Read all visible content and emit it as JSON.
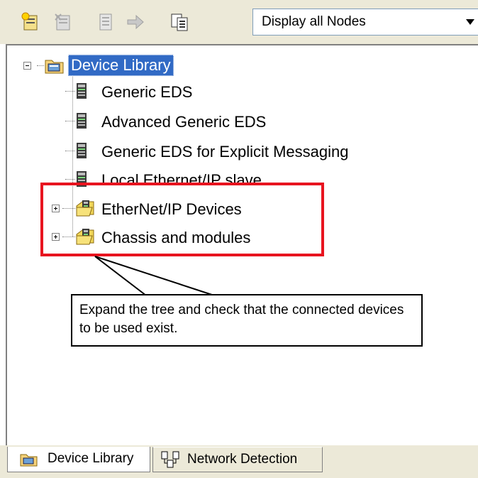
{
  "toolbar": {
    "buttons": [
      {
        "icon": "add-device-icon"
      },
      {
        "icon": "remove-device-icon"
      },
      {
        "icon": "properties-icon"
      },
      {
        "icon": "arrow-right-icon"
      },
      {
        "icon": "copy-icon"
      }
    ],
    "filter_value": "Display all Nodes"
  },
  "tree": {
    "root": {
      "label": "Device Library",
      "selected": true,
      "expanded": true
    },
    "items": [
      {
        "label": "Generic EDS",
        "icon": "device-icon",
        "expandable": false
      },
      {
        "label": "Advanced Generic EDS",
        "icon": "device-icon",
        "expandable": false
      },
      {
        "label": "Generic EDS for Explicit Messaging",
        "icon": "device-icon",
        "expandable": false
      },
      {
        "label": "Local Ethernet/IP slave",
        "icon": "device-icon",
        "expandable": false
      },
      {
        "label": "EtherNet/IP Devices",
        "icon": "device-folder-icon",
        "expandable": true
      },
      {
        "label": "Chassis and modules",
        "icon": "device-folder-icon",
        "expandable": true
      }
    ]
  },
  "callout": {
    "text": "Expand the tree and check that the connected devices to be used exist."
  },
  "tabs": {
    "device_library": "Device Library",
    "network_detection": "Network Detection"
  },
  "colors": {
    "selection": "#316ac5",
    "highlight": "#e8141f",
    "toolbar_bg": "#ece9d8"
  }
}
